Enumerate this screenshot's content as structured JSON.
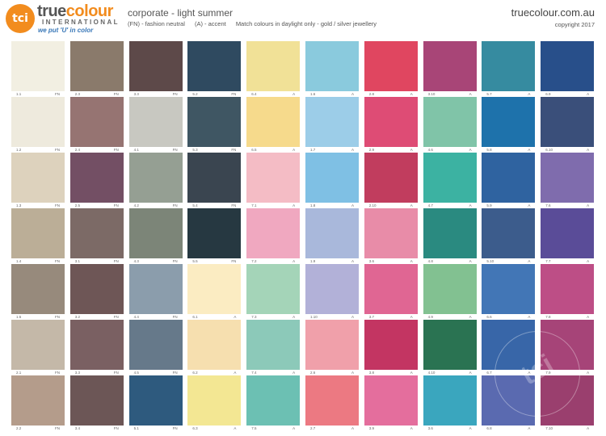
{
  "header": {
    "logo_mark": "tci",
    "brand_true": "true",
    "brand_colour": "colour",
    "brand_sub": "INTERNATIONAL",
    "tagline": "we put 'U' in color",
    "palette_title": "corporate - light summer",
    "legend_fn": "(FN) - fashion neutral",
    "legend_a": "(A) - accent",
    "note": "Match colours in daylight only - gold / silver jewellery",
    "website": "truecolour.com.au",
    "copyright": "copyright 2017"
  },
  "watermark": "tci",
  "rows": [
    [
      {
        "code": "1.1",
        "type": "FN",
        "color": "#f2efe2"
      },
      {
        "code": "2.3",
        "type": "FN",
        "color": "#8a7a6b"
      },
      {
        "code": "3.3",
        "type": "FN",
        "color": "#5d4949"
      },
      {
        "code": "5.2",
        "type": "FN",
        "color": "#2f4a60"
      },
      {
        "code": "6.4",
        "type": "A",
        "color": "#f1e197"
      },
      {
        "code": "1.6",
        "type": "A",
        "color": "#8acadd"
      },
      {
        "code": "2.8",
        "type": "A",
        "color": "#e04660"
      },
      {
        "code": "3.10",
        "type": "A",
        "color": "#a84577"
      },
      {
        "code": "5.7",
        "type": "A",
        "color": "#368ba0"
      },
      {
        "code": "6.9",
        "type": "A",
        "color": "#284f8a"
      }
    ],
    [
      {
        "code": "1.2",
        "type": "FN",
        "color": "#eeeadd"
      },
      {
        "code": "2.4",
        "type": "FN",
        "color": "#967472"
      },
      {
        "code": "4.1",
        "type": "FN",
        "color": "#c8c8c1"
      },
      {
        "code": "5.3",
        "type": "FN",
        "color": "#3f5663"
      },
      {
        "code": "6.5",
        "type": "A",
        "color": "#f6da8c"
      },
      {
        "code": "1.7",
        "type": "A",
        "color": "#9ccde8"
      },
      {
        "code": "2.9",
        "type": "A",
        "color": "#de4c75"
      },
      {
        "code": "4.6",
        "type": "A",
        "color": "#80c4a8"
      },
      {
        "code": "5.8",
        "type": "A",
        "color": "#1e72ab"
      },
      {
        "code": "6.10",
        "type": "A",
        "color": "#3a4f7a"
      }
    ],
    [
      {
        "code": "1.3",
        "type": "FN",
        "color": "#ddd2bd"
      },
      {
        "code": "2.5",
        "type": "FN",
        "color": "#734f64"
      },
      {
        "code": "4.2",
        "type": "FN",
        "color": "#959f93"
      },
      {
        "code": "5.4",
        "type": "FN",
        "color": "#3a4550"
      },
      {
        "code": "7.1",
        "type": "A",
        "color": "#f4bcc5"
      },
      {
        "code": "1.8",
        "type": "A",
        "color": "#7fc0e4"
      },
      {
        "code": "2.10",
        "type": "A",
        "color": "#c13d5e"
      },
      {
        "code": "4.7",
        "type": "A",
        "color": "#3cb2a2"
      },
      {
        "code": "5.9",
        "type": "A",
        "color": "#2f63a0"
      },
      {
        "code": "7.6",
        "type": "A",
        "color": "#7f6cad"
      }
    ],
    [
      {
        "code": "1.4",
        "type": "FN",
        "color": "#bbae97"
      },
      {
        "code": "3.1",
        "type": "FN",
        "color": "#7c6a66"
      },
      {
        "code": "4.3",
        "type": "FN",
        "color": "#7c8578"
      },
      {
        "code": "5.5",
        "type": "FN",
        "color": "#263841"
      },
      {
        "code": "7.2",
        "type": "A",
        "color": "#f0a8c0"
      },
      {
        "code": "1.9",
        "type": "A",
        "color": "#a9b8db"
      },
      {
        "code": "3.6",
        "type": "A",
        "color": "#e88ca8"
      },
      {
        "code": "4.8",
        "type": "A",
        "color": "#2a8a80"
      },
      {
        "code": "5.10",
        "type": "A",
        "color": "#3c5c8c"
      },
      {
        "code": "7.7",
        "type": "A",
        "color": "#5a4c98"
      }
    ],
    [
      {
        "code": "1.5",
        "type": "FN",
        "color": "#978a7c"
      },
      {
        "code": "3.2",
        "type": "FN",
        "color": "#6e5656"
      },
      {
        "code": "4.4",
        "type": "FN",
        "color": "#8b9dac"
      },
      {
        "code": "6.1",
        "type": "A",
        "color": "#fbecc2"
      },
      {
        "code": "7.3",
        "type": "A",
        "color": "#a4d4b8"
      },
      {
        "code": "1.10",
        "type": "A",
        "color": "#b2b1d8"
      },
      {
        "code": "3.7",
        "type": "A",
        "color": "#e06693"
      },
      {
        "code": "4.9",
        "type": "A",
        "color": "#82c191"
      },
      {
        "code": "6.6",
        "type": "A",
        "color": "#4276b6"
      },
      {
        "code": "7.8",
        "type": "A",
        "color": "#bd4e86"
      }
    ],
    [
      {
        "code": "2.1",
        "type": "FN",
        "color": "#c4b8a8"
      },
      {
        "code": "3.3",
        "type": "FN",
        "color": "#7a6062"
      },
      {
        "code": "4.5",
        "type": "FN",
        "color": "#66798a"
      },
      {
        "code": "6.2",
        "type": "A",
        "color": "#f6dfaf"
      },
      {
        "code": "7.4",
        "type": "A",
        "color": "#8cc9b9"
      },
      {
        "code": "2.6",
        "type": "A",
        "color": "#f0a0aa"
      },
      {
        "code": "3.8",
        "type": "A",
        "color": "#c33562"
      },
      {
        "code": "4.10",
        "type": "A",
        "color": "#2a7352"
      },
      {
        "code": "6.7",
        "type": "A",
        "color": "#3866a8"
      },
      {
        "code": "7.9",
        "type": "A",
        "color": "#a64478"
      }
    ],
    [
      {
        "code": "2.2",
        "type": "FN",
        "color": "#b49c8b"
      },
      {
        "code": "3.4",
        "type": "FN",
        "color": "#6c5656"
      },
      {
        "code": "5.1",
        "type": "FN",
        "color": "#2e5a7e"
      },
      {
        "code": "6.3",
        "type": "A",
        "color": "#f3e793"
      },
      {
        "code": "7.5",
        "type": "A",
        "color": "#6cc0b3"
      },
      {
        "code": "2.7",
        "type": "A",
        "color": "#ec7982"
      },
      {
        "code": "3.9",
        "type": "A",
        "color": "#e46e9d"
      },
      {
        "code": "3.6",
        "type": "A",
        "color": "#3aa6be"
      },
      {
        "code": "6.8",
        "type": "A",
        "color": "#5a6ab0"
      },
      {
        "code": "7.10",
        "type": "A",
        "color": "#9a3f6e"
      }
    ]
  ]
}
